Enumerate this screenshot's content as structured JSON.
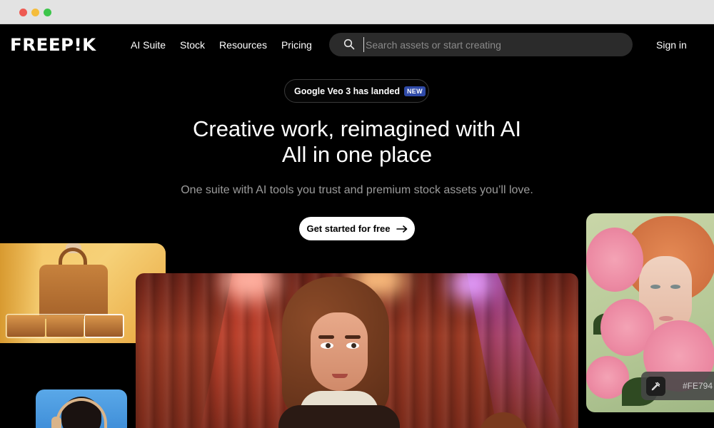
{
  "nav": {
    "logo": "FREEP!K",
    "links": [
      "AI Suite",
      "Stock",
      "Resources",
      "Pricing"
    ],
    "search_placeholder": "Search assets or start creating",
    "sign_in": "Sign in"
  },
  "announcement": {
    "text": "Google Veo 3 has landed",
    "badge": "NEW"
  },
  "hero": {
    "title_line1": "Creative work, reimagined with AI",
    "title_line2": "All in one place",
    "subtitle": "One suite with AI tools you trust and premium stock assets you’ll love.",
    "cta": "Get started for free"
  },
  "color_picker": {
    "hex": "#FE794"
  },
  "colors": {
    "background": "#000000",
    "search_bg": "#2b2b2b",
    "badge_bg": "#2f4aa8",
    "subtitle": "#9b9b9b"
  },
  "icons": {
    "search": "search-icon",
    "cta_arrow": "arrow-right-icon",
    "eyedropper": "eyedropper-icon"
  }
}
